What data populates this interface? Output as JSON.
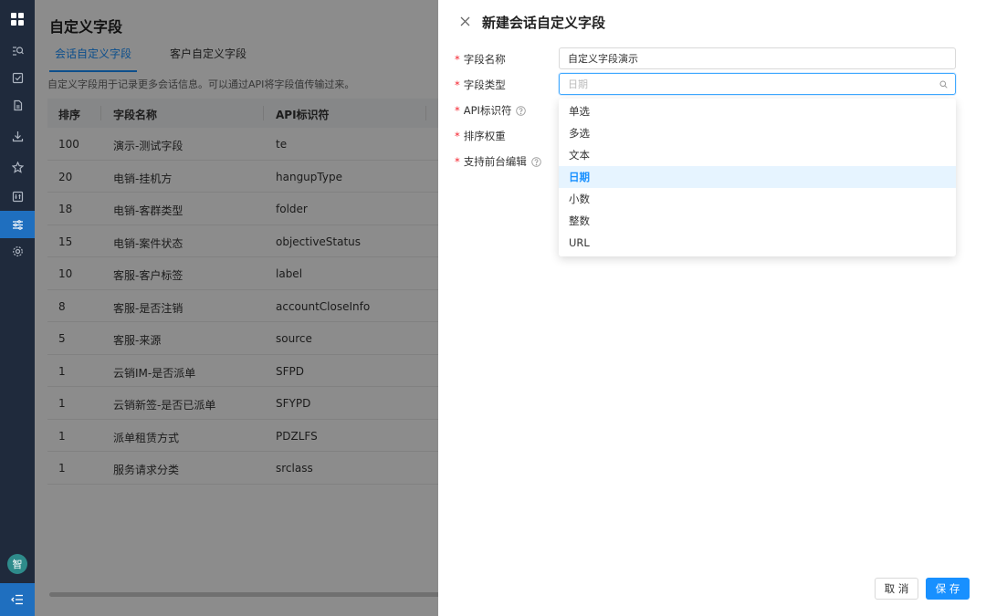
{
  "page": {
    "title": "自定义字段",
    "tabs": [
      {
        "label": "会话自定义字段",
        "active": true
      },
      {
        "label": "客户自定义字段",
        "active": false
      }
    ],
    "description": "自定义字段用于记录更多会话信息。可以通过API将字段值传输过来。",
    "table": {
      "columns": [
        "排序",
        "字段名称",
        "API标识符"
      ],
      "rows": [
        [
          "100",
          "演示-测试字段",
          "te"
        ],
        [
          "20",
          "电销-挂机方",
          "hangupType"
        ],
        [
          "18",
          "电销-客群类型",
          "folder"
        ],
        [
          "15",
          "电销-案件状态",
          "objectiveStatus"
        ],
        [
          "10",
          "客服-客户标签",
          "label"
        ],
        [
          "8",
          "客服-是否注销",
          "accountCloseInfo"
        ],
        [
          "5",
          "客服-来源",
          "source"
        ],
        [
          "1",
          "云销IM-是否派单",
          "SFPD"
        ],
        [
          "1",
          "云销新签-是否已派单",
          "SFYPD"
        ],
        [
          "1",
          "派单租赁方式",
          "PDZLFS"
        ],
        [
          "1",
          "服务请求分类",
          "srclass"
        ]
      ]
    }
  },
  "nav": {
    "avatar_text": "智"
  },
  "drawer": {
    "title": "新建会话自定义字段",
    "fields": {
      "name_label": "字段名称",
      "name_value": "自定义字段演示",
      "type_label": "字段类型",
      "type_placeholder": "日期",
      "api_label": "API标识符",
      "order_label": "排序权重",
      "frontend_label": "支持前台编辑"
    },
    "required_mark": "*",
    "type_options": [
      "单选",
      "多选",
      "文本",
      "日期",
      "小数",
      "整数",
      "URL"
    ],
    "selected_option": "日期",
    "cancel_label": "取 消",
    "save_label": "保 存"
  },
  "colors": {
    "primary": "#1890ff",
    "nav_bg": "#1f2a3c",
    "nav_active": "#1f6fbf",
    "required": "#f5222d"
  }
}
